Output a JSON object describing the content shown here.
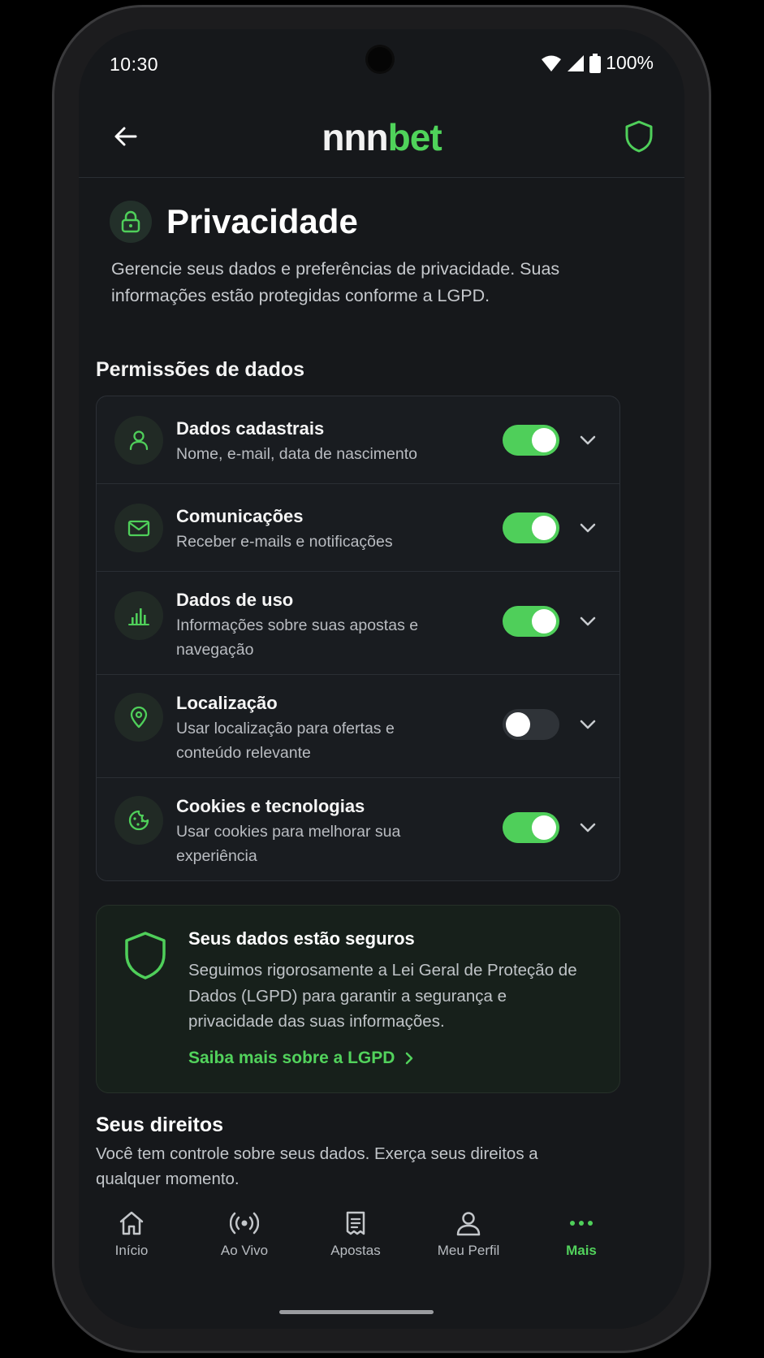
{
  "status_bar": {
    "time": "10:30",
    "battery": "100%",
    "icons": [
      "wifi-icon",
      "signal-icon",
      "battery-icon"
    ]
  },
  "header": {
    "logo_part1": "nnn",
    "logo_part2": "bet",
    "back_icon": "arrow-left-icon",
    "shield_icon": "shield-icon"
  },
  "page": {
    "title": "Privacidade",
    "description": "Gerencie seus dados e preferências de privacidade. Suas informações estão protegidas conforme a LGPD."
  },
  "permissions": {
    "section_title": "Permissões de dados",
    "items": [
      {
        "icon": "user-icon",
        "title": "Dados cadastrais",
        "desc": "Nome, e-mail, data de nascimento",
        "enabled": true
      },
      {
        "icon": "mail-icon",
        "title": "Comunicações",
        "desc": "Receber e-mails e notificações",
        "enabled": true
      },
      {
        "icon": "chart-icon",
        "title": "Dados de uso",
        "desc": "Informações sobre suas apostas e navegação",
        "enabled": true
      },
      {
        "icon": "location-pin-icon",
        "title": "Localização",
        "desc": "Usar localização para ofertas e conteúdo relevante",
        "enabled": false
      },
      {
        "icon": "cookie-icon",
        "title": "Cookies e tecnologias",
        "desc": "Usar cookies para melhorar sua experiência",
        "enabled": true
      }
    ]
  },
  "secure_card": {
    "title": "Seus dados estão seguros",
    "text": "Seguimos rigorosamente a Lei Geral de Proteção de Dados (LGPD) para garantir a segurança e privacidade das suas informações.",
    "link": "Saiba mais sobre a LGPD"
  },
  "rights": {
    "title": "Seus direitos",
    "desc": "Você tem controle sobre seus dados. Exerça seus direitos a qualquer momento."
  },
  "bottom_nav": {
    "items": [
      {
        "label": "Início",
        "icon": "home-icon",
        "active": false
      },
      {
        "label": "Ao Vivo",
        "icon": "live-broadcast-icon",
        "active": false
      },
      {
        "label": "Apostas",
        "icon": "betslip-icon",
        "active": false
      },
      {
        "label": "Meu Perfil",
        "icon": "profile-icon",
        "active": false
      },
      {
        "label": "Mais",
        "icon": "more-dots-icon",
        "active": true
      }
    ]
  },
  "colors": {
    "accent": "#4fcf5a",
    "background": "#16181b",
    "card": "#191c20"
  }
}
